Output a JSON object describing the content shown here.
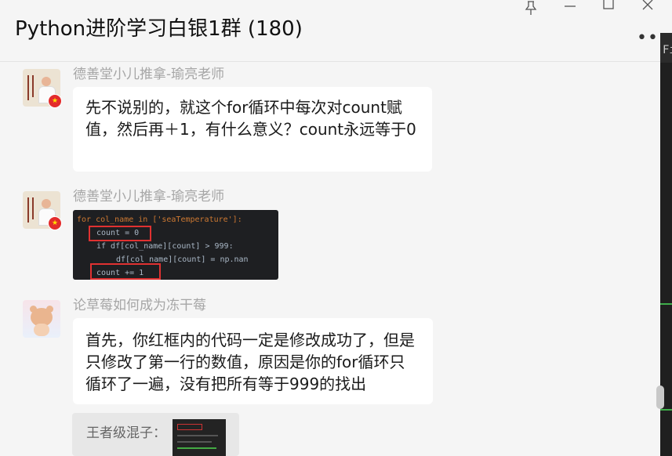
{
  "window": {
    "title": "Python进阶学习白银1群 (180)",
    "pin_icon": "pin-icon",
    "minimize_icon": "minimize-icon",
    "maximize_icon": "maximize-icon",
    "close_icon": "close-icon",
    "more_label": "•••"
  },
  "messages": [
    {
      "sender": "德善堂小儿推拿-瑜亮老师",
      "text": "先不说别的，就这个for循环中每次对count赋值，然后再＋1，有什么意义？count永远等于0"
    },
    {
      "sender": "德善堂小儿推拿-瑜亮老师",
      "code_lines": [
        "for col_name in ['seaTemperature']:",
        "count = 0",
        "if df[col_name][count] > 999:",
        "df[col_name][count] = np.nan",
        "count += 1"
      ]
    },
    {
      "sender": "论草莓如何成为冻干莓",
      "text": "首先，你红框内的代码一定是修改成功了，但是只修改了第一行的数值，原因是你的for循环只循环了一遍，没有把所有等于999的找出"
    }
  ],
  "quote": {
    "label": "王者级混子："
  },
  "flag_glyph": "★",
  "right_strip_glyph": "Fi",
  "colors": {
    "background": "#f5f5f5",
    "bubble": "#ffffff",
    "sender": "#a6a6a6",
    "highlight_box": "#e03131"
  }
}
